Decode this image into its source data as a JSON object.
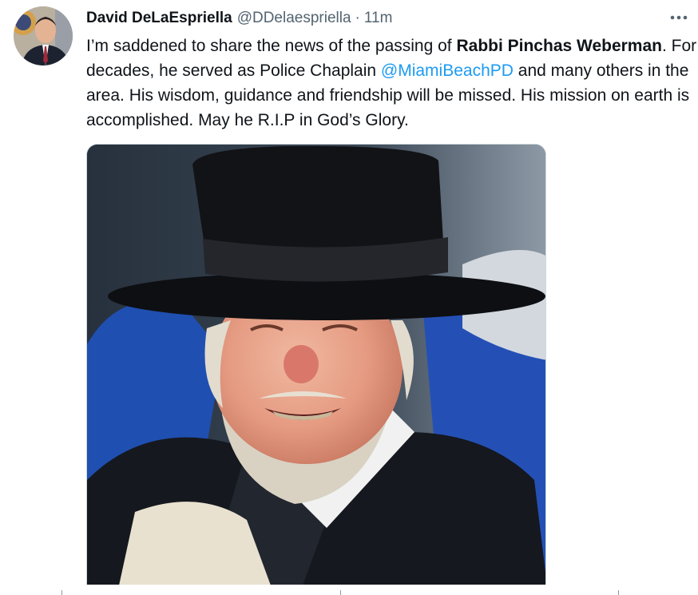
{
  "tweet": {
    "author_name": "David DeLaEspriella",
    "author_handle": "@DDelaespriella",
    "separator": "·",
    "time": "11m",
    "more_icon": "more-icon",
    "text_1": "I’m saddened to share the news of the passing of ",
    "text_bold": "Rabbi Pinchas Weberman",
    "text_2": ".  For decades, he served as Police Chaplain ",
    "mention": "@MiamiBeachPD",
    "text_3": " and many others in the area. His wisdom, guidance and friendship will be missed.  His mission on earth is accomplished.  May he R.I.P in God’s Glory.",
    "media_description_icon": "photo-icon"
  },
  "colors": {
    "text": "#0f1419",
    "secondary": "#536471",
    "link": "#1d9bf0"
  }
}
